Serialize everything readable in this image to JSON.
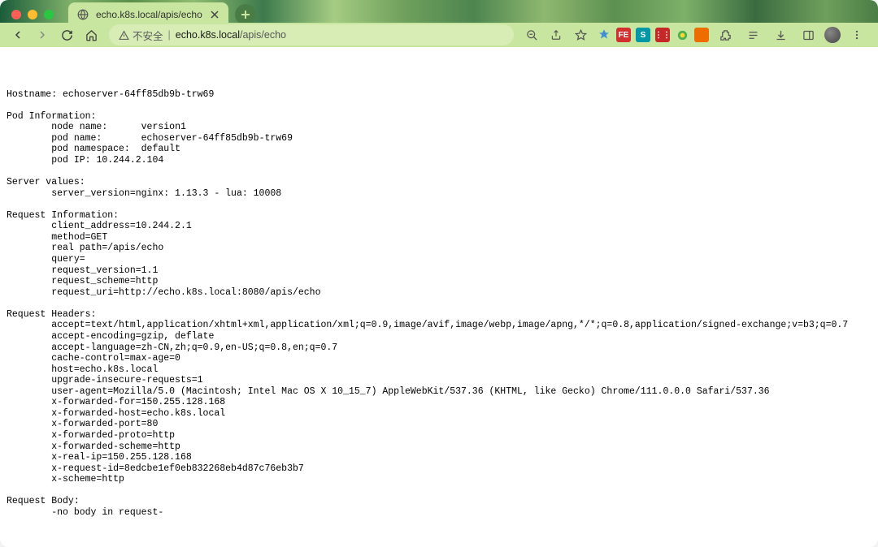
{
  "tab": {
    "title": "echo.k8s.local/apis/echo"
  },
  "address": {
    "warning": "不安全",
    "host": "echo.k8s.local",
    "path": "/apis/echo"
  },
  "response": {
    "hostname_label": "Hostname:",
    "hostname": "echoserver-64ff85db9b-trw69",
    "pod_info_label": "Pod Information:",
    "pod": {
      "node_name_label": "node name:",
      "node_name": "version1",
      "pod_name_label": "pod name:",
      "pod_name": "echoserver-64ff85db9b-trw69",
      "pod_namespace_label": "pod namespace:",
      "pod_namespace": "default",
      "pod_ip_label": "pod IP:",
      "pod_ip": "10.244.2.104"
    },
    "server_values_label": "Server values:",
    "server_version": "server_version=nginx: 1.13.3 - lua: 10008",
    "request_info_label": "Request Information:",
    "request": {
      "client_address": "client_address=10.244.2.1",
      "method": "method=GET",
      "real_path": "real path=/apis/echo",
      "query": "query=",
      "request_version": "request_version=1.1",
      "request_scheme": "request_scheme=http",
      "request_uri": "request_uri=http://echo.k8s.local:8080/apis/echo"
    },
    "request_headers_label": "Request Headers:",
    "headers": {
      "accept": "accept=text/html,application/xhtml+xml,application/xml;q=0.9,image/avif,image/webp,image/apng,*/*;q=0.8,application/signed-exchange;v=b3;q=0.7",
      "accept_encoding": "accept-encoding=gzip, deflate",
      "accept_language": "accept-language=zh-CN,zh;q=0.9,en-US;q=0.8,en;q=0.7",
      "cache_control": "cache-control=max-age=0",
      "host": "host=echo.k8s.local",
      "upgrade_insecure": "upgrade-insecure-requests=1",
      "user_agent": "user-agent=Mozilla/5.0 (Macintosh; Intel Mac OS X 10_15_7) AppleWebKit/537.36 (KHTML, like Gecko) Chrome/111.0.0.0 Safari/537.36",
      "x_forwarded_for": "x-forwarded-for=150.255.128.168",
      "x_forwarded_host": "x-forwarded-host=echo.k8s.local",
      "x_forwarded_port": "x-forwarded-port=80",
      "x_forwarded_proto": "x-forwarded-proto=http",
      "x_forwarded_scheme": "x-forwarded-scheme=http",
      "x_real_ip": "x-real-ip=150.255.128.168",
      "x_request_id": "x-request-id=8edcbe1ef0eb832268eb4d87c76eb3b7",
      "x_scheme": "x-scheme=http"
    },
    "request_body_label": "Request Body:",
    "request_body": "-no body in request-"
  }
}
